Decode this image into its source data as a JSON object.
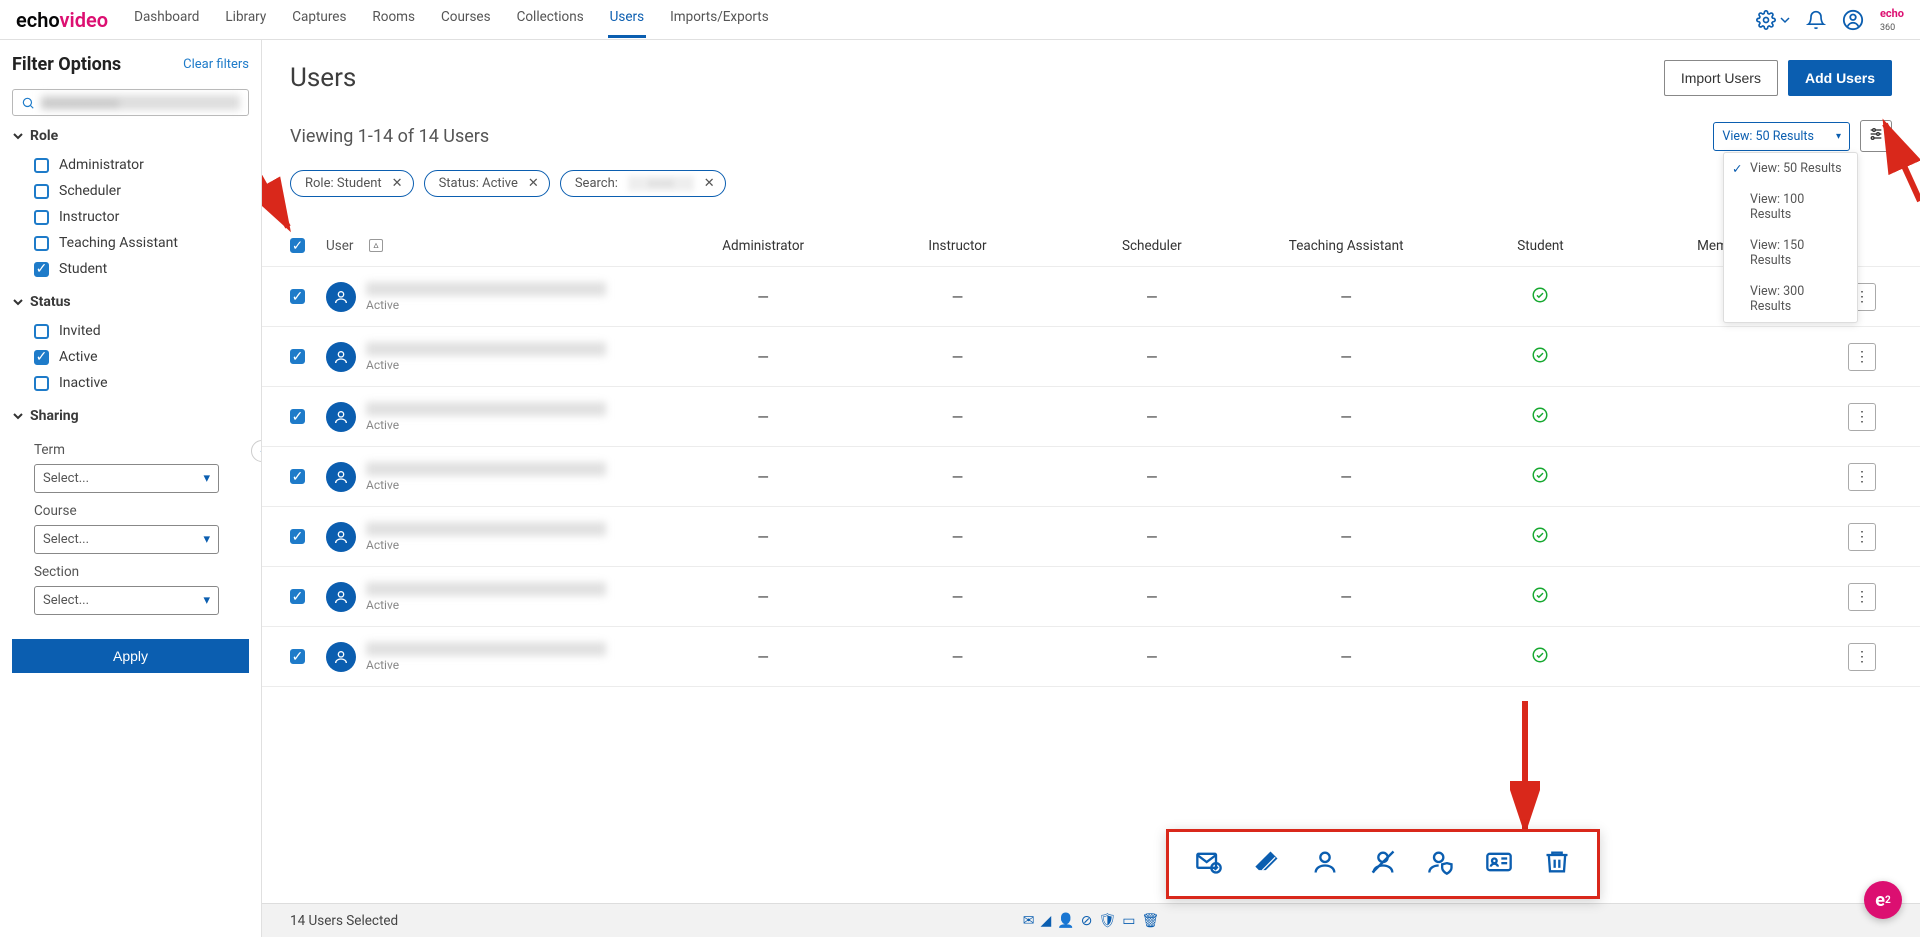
{
  "brand": {
    "a": "echo",
    "b": "video"
  },
  "nav": {
    "dashboard": "Dashboard",
    "library": "Library",
    "captures": "Captures",
    "rooms": "Rooms",
    "courses": "Courses",
    "collections": "Collections",
    "users": "Users",
    "imports": "Imports/Exports"
  },
  "e360": {
    "brand": "echo",
    "sub": "360"
  },
  "sidebar": {
    "title": "Filter Options",
    "clear": "Clear filters",
    "search_value": "xxxxxxxxxxxx",
    "role_hdr": "Role",
    "roles": [
      {
        "label": "Administrator",
        "checked": false
      },
      {
        "label": "Scheduler",
        "checked": false
      },
      {
        "label": "Instructor",
        "checked": false
      },
      {
        "label": "Teaching Assistant",
        "checked": false
      },
      {
        "label": "Student",
        "checked": true
      }
    ],
    "status_hdr": "Status",
    "statuses": [
      {
        "label": "Invited",
        "checked": false
      },
      {
        "label": "Active",
        "checked": true
      },
      {
        "label": "Inactive",
        "checked": false
      }
    ],
    "sharing_hdr": "Sharing",
    "term_lbl": "Term",
    "course_lbl": "Course",
    "section_lbl": "Section",
    "select_ph": "Select...",
    "apply": "Apply"
  },
  "page": {
    "title": "Users",
    "import_btn": "Import Users",
    "add_btn": "Add Users",
    "summary": "Viewing 1-14 of 14 Users",
    "view_sel": "View: 50 Results",
    "view_opts": [
      "View: 50 Results",
      "View: 100 Results",
      "View: 150 Results",
      "View: 300 Results"
    ]
  },
  "chips": [
    {
      "label": "Role: Student"
    },
    {
      "label": "Status: Active"
    },
    {
      "label": "Search:",
      "blurred": true
    }
  ],
  "cols": {
    "user": "User",
    "admin": "Administrator",
    "instructor": "Instructor",
    "scheduler": "Scheduler",
    "ta": "Teaching Assistant",
    "student": "Student",
    "membership": "Membership"
  },
  "row_status": "Active",
  "footer": {
    "selected": "14 Users Selected"
  },
  "dash": "—",
  "rows": 7
}
